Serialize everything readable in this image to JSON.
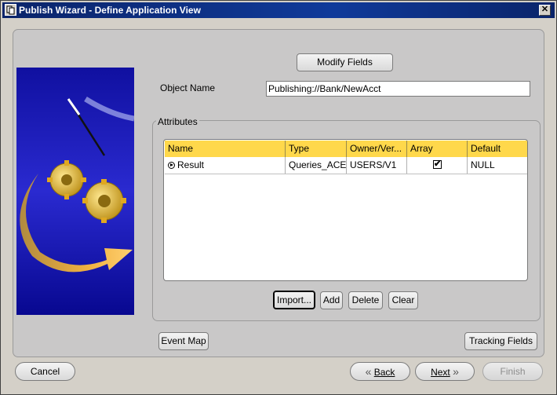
{
  "window": {
    "title": "Publish Wizard - Define Application View",
    "close_label": "✕"
  },
  "header": {
    "modify_fields_label": "Modify Fields"
  },
  "object_name": {
    "label": "Object Name",
    "value": "Publishing://Bank/NewAcct"
  },
  "attributes": {
    "group_title": "Attributes",
    "columns": [
      "Name",
      "Type",
      "Owner/Ver...",
      "Array",
      "Default"
    ],
    "rows": [
      {
        "name": "Result",
        "type": "Queries_ACE",
        "owner": "USERS/V1",
        "array": true,
        "array_mark": "✔",
        "default": "NULL"
      }
    ],
    "buttons": {
      "import": "Import...",
      "add": "Add",
      "delete": "Delete",
      "clear": "Clear"
    }
  },
  "footer_panel": {
    "event_map": "Event Map",
    "tracking_fields": "Tracking Fields"
  },
  "navigation": {
    "cancel": "Cancel",
    "back": "Back",
    "next": "Next",
    "finish": "Finish"
  },
  "colors": {
    "titlebar": "#0a246a",
    "table_header": "#ffd84b",
    "panel": "#c9c8c8",
    "image_background": "#1a1ab0"
  }
}
